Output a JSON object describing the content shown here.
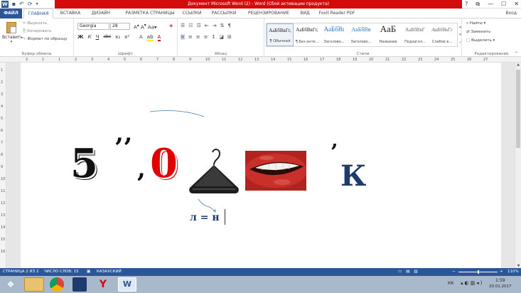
{
  "title_bar": {
    "document_title": "Документ Microsoft Word (2) - Word (Сбой активации продукта)",
    "controls": [
      "?",
      "⧉",
      "—",
      "☐",
      "✕"
    ]
  },
  "quick_access": [
    "save-icon",
    "undo-icon",
    "redo-icon",
    "customize-icon"
  ],
  "tabs": [
    "ФАЙЛ",
    "ГЛАВНАЯ",
    "ВСТАВКА",
    "ДИЗАЙН",
    "РАЗМЕТКА СТРАНИЦЫ",
    "ССЫЛКИ",
    "РАССЫЛКИ",
    "РЕЦЕНЗИРОВАНИЕ",
    "ВИД",
    "Foxit Reader PDF"
  ],
  "user": "Вход",
  "clipboard": {
    "paste": "Вставить",
    "cut": "Вырезать",
    "copy": "Копировать",
    "format": "Формат по образцу",
    "label": "Буфер обмена"
  },
  "font": {
    "family": "Georgia",
    "size": "28",
    "label": "Шрифт",
    "buttons": [
      "Ж",
      "К",
      "Ч",
      "abc",
      "x₂",
      "x²"
    ]
  },
  "paragraph": {
    "label": "Абзац"
  },
  "styles": {
    "label": "Стили",
    "items": [
      {
        "preview": "АаБбВвГг,",
        "name": "¶ Обычный"
      },
      {
        "preview": "АаБбВвГг,",
        "name": "¶ Без инте..."
      },
      {
        "preview": "АаБбВı",
        "name": "Заголово..."
      },
      {
        "preview": "АаБбВв",
        "name": "Заголово..."
      },
      {
        "preview": "АаБ",
        "name": "Название"
      },
      {
        "preview": "АаБбВвГ",
        "name": "Подзагол..."
      },
      {
        "preview": "АаБбВвГг",
        "name": "Слабое в..."
      }
    ]
  },
  "editing": {
    "find": "Найти",
    "replace": "Заменить",
    "select": "Выделить",
    "label": "Редактирование"
  },
  "ruler": {
    "numbers": [
      "2",
      "1",
      "1",
      "2",
      "3",
      "4",
      "5",
      "6",
      "7",
      "8",
      "9",
      "10",
      "11",
      "12",
      "13",
      "14",
      "15",
      "16",
      "17",
      "18",
      "19",
      "20",
      "21",
      "22",
      "23",
      "24",
      "25",
      "26",
      "27"
    ],
    "v_numbers": [
      "1",
      "2",
      "3",
      "4",
      "5",
      "6",
      "7",
      "8",
      "9",
      "10",
      "11",
      "12",
      "13",
      "14",
      "15",
      "16"
    ]
  },
  "document": {
    "rebus": {
      "digit": "5",
      "commas_top": "’’",
      "comma_mid": ",",
      "zero": "0",
      "comma_right": "’",
      "letter": "К",
      "formula": "л = н"
    }
  },
  "status": {
    "page": "СТРАНИЦА 2 ИЗ 2",
    "words": "ЧИСЛО СЛОВ: 15",
    "lang": "КАЗАХСКИЙ",
    "zoom": "110%"
  },
  "taskbar": {
    "lang": "КК",
    "time": "1:59",
    "date": "20.01.2017"
  },
  "colors": {
    "word_blue": "#2b579a",
    "activation_red": "#d40b0b",
    "rebus_red": "#e00000",
    "rebus_navy": "#1e3a6e"
  }
}
